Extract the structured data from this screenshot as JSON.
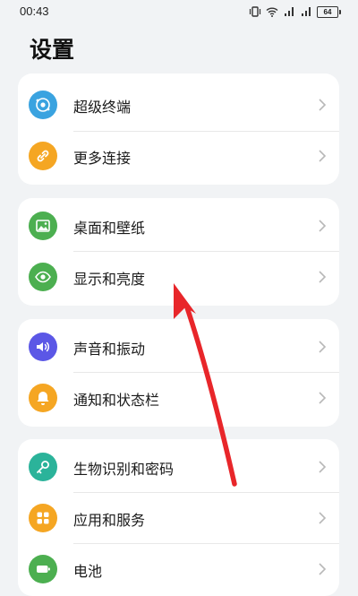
{
  "status_bar": {
    "time": "00:43",
    "battery": "64"
  },
  "page": {
    "title": "设置"
  },
  "cards": [
    {
      "items": [
        {
          "label": "超级终端",
          "icon": "super-device-icon",
          "color": "#3aa3e0"
        },
        {
          "label": "更多连接",
          "icon": "link-icon",
          "color": "#f5a623"
        }
      ]
    },
    {
      "items": [
        {
          "label": "桌面和壁纸",
          "icon": "wallpaper-icon",
          "color": "#4caf50"
        },
        {
          "label": "显示和亮度",
          "icon": "eye-icon",
          "color": "#4caf50"
        }
      ]
    },
    {
      "items": [
        {
          "label": "声音和振动",
          "icon": "sound-icon",
          "color": "#5b57e6"
        },
        {
          "label": "通知和状态栏",
          "icon": "bell-icon",
          "color": "#f5a623"
        }
      ]
    },
    {
      "items": [
        {
          "label": "生物识别和密码",
          "icon": "key-icon",
          "color": "#2bb39a"
        },
        {
          "label": "应用和服务",
          "icon": "apps-icon",
          "color": "#f5a623"
        },
        {
          "label": "电池",
          "icon": "battery-icon",
          "color": "#4caf50"
        }
      ]
    }
  ],
  "annotation": {
    "color": "#e8262a"
  }
}
